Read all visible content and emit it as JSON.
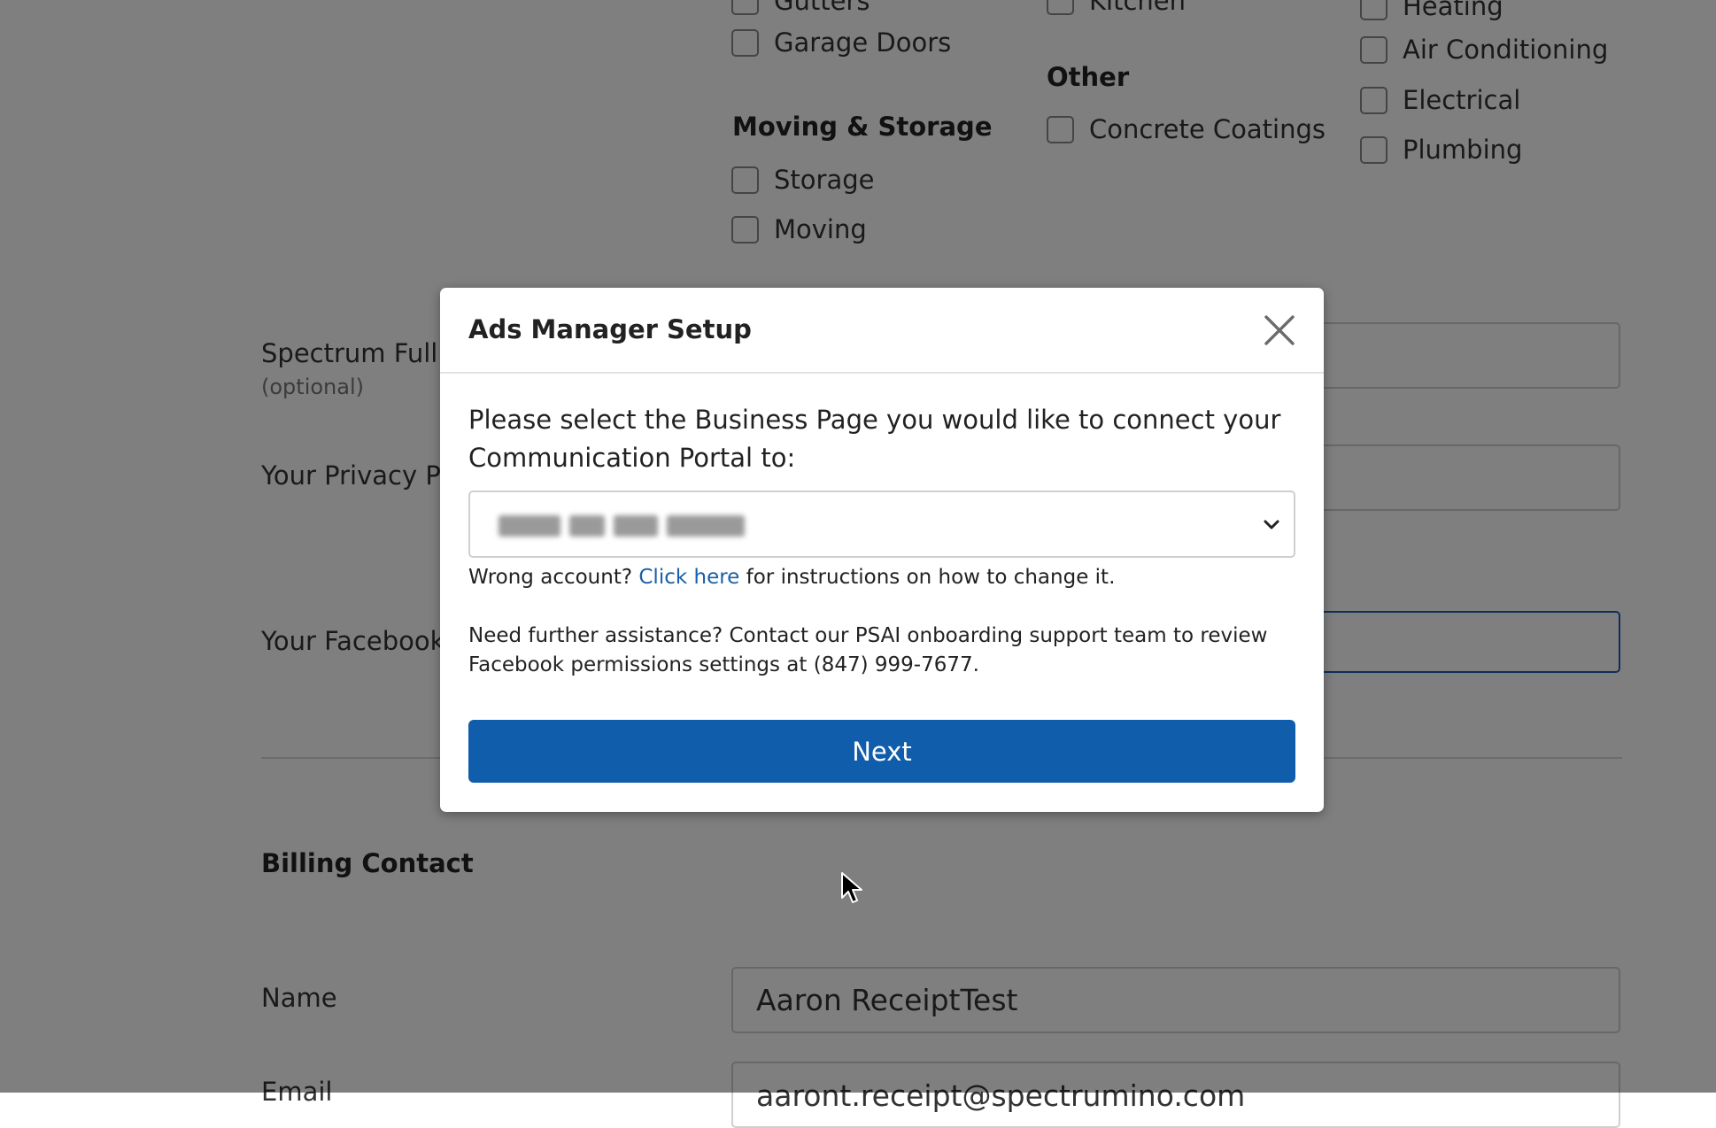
{
  "form": {
    "services": {
      "column1": {
        "items_top": [
          "Gutters",
          "Garage Doors"
        ],
        "group_moving": "Moving & Storage",
        "items_moving": [
          "Storage",
          "Moving"
        ]
      },
      "column2": {
        "items_top": [
          "Kitchen"
        ],
        "group_other": "Other",
        "items_other": [
          "Concrete Coatings"
        ]
      },
      "column3": {
        "items": [
          "Heating",
          "Air Conditioning",
          "Electrical",
          "Plumbing"
        ]
      }
    },
    "fields": {
      "spectrum_label": "Spectrum Full S",
      "spectrum_sub": "(optional)",
      "privacy_label": "Your Privacy Po",
      "facebook_label": "Your Facebook"
    },
    "billing": {
      "title": "Billing Contact",
      "name_label": "Name",
      "name_value": "Aaron ReceiptTest",
      "email_label": "Email",
      "email_value": "aaront.receipt@spectrumino.com"
    }
  },
  "modal": {
    "title": "Ads Manager Setup",
    "prompt": "Please select the Business Page you would like to connect your Communication Portal to:",
    "wrong_account_prefix": "Wrong account?",
    "wrong_account_link": "Click here",
    "wrong_account_suffix": "for instructions on how to change it.",
    "assistance": "Need further assistance? Contact our PSAI onboarding support team to review Facebook permissions settings at (847) 999-7677.",
    "next_label": "Next"
  },
  "colors": {
    "primary_button": "#0f5dab",
    "link": "#1a5fa8",
    "overlay": "rgba(0,0,0,0.5)"
  }
}
